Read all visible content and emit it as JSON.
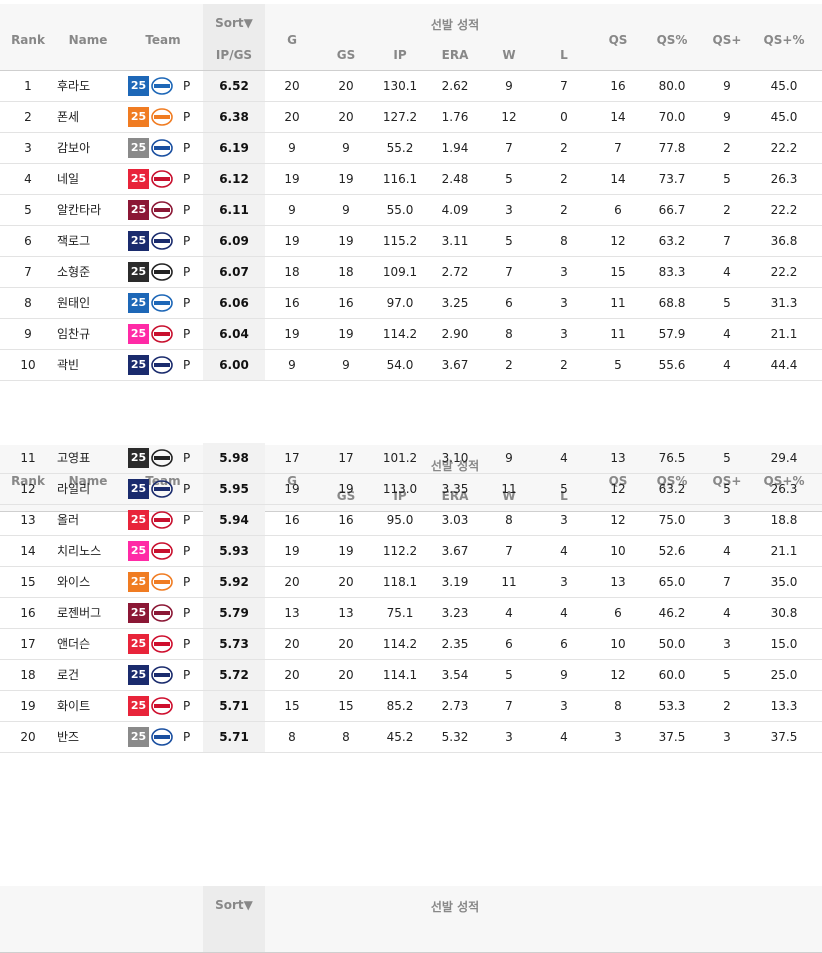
{
  "header": {
    "rank": "Rank",
    "name": "Name",
    "team": "Team",
    "sort": "Sort▼",
    "ipgs": "IP/GS",
    "g": "G",
    "group": "선발 성적",
    "gs": "GS",
    "ip": "IP",
    "era": "ERA",
    "w": "W",
    "l": "L",
    "qs": "QS",
    "qs_pct": "QS%",
    "qs_plus": "QS+",
    "qs_plus_pct": "QS+%"
  },
  "teams": {
    "dinos": {
      "color": "#1d67b7",
      "logo": "dinos-logo-icon",
      "logo_color": "#1d67b7"
    },
    "eagles": {
      "color": "#f07c22",
      "logo": "eagles-logo-icon",
      "logo_color": "#f07c22"
    },
    "lions": {
      "color": "#8a8a8a",
      "logo": "lions-logo-icon",
      "logo_color": "#1a4fa0"
    },
    "twins": {
      "color": "#e8243a",
      "logo": "twins-logo-icon",
      "logo_color": "#c8102e"
    },
    "wiz": {
      "color": "#2b2b2b",
      "logo": "wiz-logo-icon",
      "logo_color": "#222"
    },
    "landers": {
      "color": "#e8243a",
      "logo": "landers-logo-icon",
      "logo_color": "#ce0e2d"
    },
    "bears": {
      "color": "#1a2b6d",
      "logo": "bears-logo-icon",
      "logo_color": "#1a2b6d"
    },
    "heroes": {
      "color": "#8b1735",
      "logo": "heroes-logo-icon",
      "logo_color": "#8b1735"
    },
    "giants": {
      "color": "#1a2b6d",
      "logo": "giants-logo-icon",
      "logo_color": "#1a2b6d"
    },
    "twins_pink": {
      "color": "#ff2aa6",
      "logo": "twins-logo-icon",
      "logo_color": "#c8102e"
    }
  },
  "sections": [
    {
      "rows": [
        {
          "rank": "1",
          "name": "후라도",
          "year": "25",
          "team": "dinos",
          "pos": "P",
          "ipgs": "6.52",
          "g": "20",
          "gs": "20",
          "ip": "130.1",
          "era": "2.62",
          "w": "9",
          "l": "7",
          "qs": "16",
          "qs_pct": "80.0",
          "qs_plus": "9",
          "qs_plus_pct": "45.0"
        },
        {
          "rank": "2",
          "name": "폰세",
          "year": "25",
          "team": "eagles",
          "pos": "P",
          "ipgs": "6.38",
          "g": "20",
          "gs": "20",
          "ip": "127.2",
          "era": "1.76",
          "w": "12",
          "l": "0",
          "qs": "14",
          "qs_pct": "70.0",
          "qs_plus": "9",
          "qs_plus_pct": "45.0"
        },
        {
          "rank": "3",
          "name": "감보아",
          "year": "25",
          "team": "lions",
          "pos": "P",
          "ipgs": "6.19",
          "g": "9",
          "gs": "9",
          "ip": "55.2",
          "era": "1.94",
          "w": "7",
          "l": "2",
          "qs": "7",
          "qs_pct": "77.8",
          "qs_plus": "2",
          "qs_plus_pct": "22.2"
        },
        {
          "rank": "4",
          "name": "네일",
          "year": "25",
          "team": "twins",
          "pos": "P",
          "ipgs": "6.12",
          "g": "19",
          "gs": "19",
          "ip": "116.1",
          "era": "2.48",
          "w": "5",
          "l": "2",
          "qs": "14",
          "qs_pct": "73.7",
          "qs_plus": "5",
          "qs_plus_pct": "26.3"
        },
        {
          "rank": "5",
          "name": "알칸타라",
          "year": "25",
          "team": "heroes",
          "pos": "P",
          "ipgs": "6.11",
          "g": "9",
          "gs": "9",
          "ip": "55.0",
          "era": "4.09",
          "w": "3",
          "l": "2",
          "qs": "6",
          "qs_pct": "66.7",
          "qs_plus": "2",
          "qs_plus_pct": "22.2"
        },
        {
          "rank": "6",
          "name": "잭로그",
          "year": "25",
          "team": "giants",
          "pos": "P",
          "ipgs": "6.09",
          "g": "19",
          "gs": "19",
          "ip": "115.2",
          "era": "3.11",
          "w": "5",
          "l": "8",
          "qs": "12",
          "qs_pct": "63.2",
          "qs_plus": "7",
          "qs_plus_pct": "36.8"
        },
        {
          "rank": "7",
          "name": "소형준",
          "year": "25",
          "team": "wiz",
          "pos": "P",
          "ipgs": "6.07",
          "g": "18",
          "gs": "18",
          "ip": "109.1",
          "era": "2.72",
          "w": "7",
          "l": "3",
          "qs": "15",
          "qs_pct": "83.3",
          "qs_plus": "4",
          "qs_plus_pct": "22.2"
        },
        {
          "rank": "8",
          "name": "원태인",
          "year": "25",
          "team": "dinos",
          "pos": "P",
          "ipgs": "6.06",
          "g": "16",
          "gs": "16",
          "ip": "97.0",
          "era": "3.25",
          "w": "6",
          "l": "3",
          "qs": "11",
          "qs_pct": "68.8",
          "qs_plus": "5",
          "qs_plus_pct": "31.3"
        },
        {
          "rank": "9",
          "name": "임찬규",
          "year": "25",
          "team": "twins_pink",
          "pos": "P",
          "ipgs": "6.04",
          "g": "19",
          "gs": "19",
          "ip": "114.2",
          "era": "2.90",
          "w": "8",
          "l": "3",
          "qs": "11",
          "qs_pct": "57.9",
          "qs_plus": "4",
          "qs_plus_pct": "21.1"
        },
        {
          "rank": "10",
          "name": "곽빈",
          "year": "25",
          "team": "giants",
          "pos": "P",
          "ipgs": "6.00",
          "g": "9",
          "gs": "9",
          "ip": "54.0",
          "era": "3.67",
          "w": "2",
          "l": "2",
          "qs": "5",
          "qs_pct": "55.6",
          "qs_plus": "4",
          "qs_plus_pct": "44.4"
        }
      ]
    },
    {
      "rows": [
        {
          "rank": "11",
          "name": "고영표",
          "year": "25",
          "team": "wiz",
          "pos": "P",
          "ipgs": "5.98",
          "g": "17",
          "gs": "17",
          "ip": "101.2",
          "era": "3.10",
          "w": "9",
          "l": "4",
          "qs": "13",
          "qs_pct": "76.5",
          "qs_plus": "5",
          "qs_plus_pct": "29.4"
        },
        {
          "rank": "12",
          "name": "라일리",
          "year": "25",
          "team": "bears",
          "pos": "P",
          "ipgs": "5.95",
          "g": "19",
          "gs": "19",
          "ip": "113.0",
          "era": "3.35",
          "w": "11",
          "l": "5",
          "qs": "12",
          "qs_pct": "63.2",
          "qs_plus": "5",
          "qs_plus_pct": "26.3"
        },
        {
          "rank": "13",
          "name": "올러",
          "year": "25",
          "team": "twins",
          "pos": "P",
          "ipgs": "5.94",
          "g": "16",
          "gs": "16",
          "ip": "95.0",
          "era": "3.03",
          "w": "8",
          "l": "3",
          "qs": "12",
          "qs_pct": "75.0",
          "qs_plus": "3",
          "qs_plus_pct": "18.8"
        },
        {
          "rank": "14",
          "name": "치리노스",
          "year": "25",
          "team": "twins_pink",
          "pos": "P",
          "ipgs": "5.93",
          "g": "19",
          "gs": "19",
          "ip": "112.2",
          "era": "3.67",
          "w": "7",
          "l": "4",
          "qs": "10",
          "qs_pct": "52.6",
          "qs_plus": "4",
          "qs_plus_pct": "21.1"
        },
        {
          "rank": "15",
          "name": "와이스",
          "year": "25",
          "team": "eagles",
          "pos": "P",
          "ipgs": "5.92",
          "g": "20",
          "gs": "20",
          "ip": "118.1",
          "era": "3.19",
          "w": "11",
          "l": "3",
          "qs": "13",
          "qs_pct": "65.0",
          "qs_plus": "7",
          "qs_plus_pct": "35.0"
        },
        {
          "rank": "16",
          "name": "로젠버그",
          "year": "25",
          "team": "heroes",
          "pos": "P",
          "ipgs": "5.79",
          "g": "13",
          "gs": "13",
          "ip": "75.1",
          "era": "3.23",
          "w": "4",
          "l": "4",
          "qs": "6",
          "qs_pct": "46.2",
          "qs_plus": "4",
          "qs_plus_pct": "30.8"
        },
        {
          "rank": "17",
          "name": "앤더슨",
          "year": "25",
          "team": "landers",
          "pos": "P",
          "ipgs": "5.73",
          "g": "20",
          "gs": "20",
          "ip": "114.2",
          "era": "2.35",
          "w": "6",
          "l": "6",
          "qs": "10",
          "qs_pct": "50.0",
          "qs_plus": "3",
          "qs_plus_pct": "15.0"
        },
        {
          "rank": "18",
          "name": "로건",
          "year": "25",
          "team": "bears",
          "pos": "P",
          "ipgs": "5.72",
          "g": "20",
          "gs": "20",
          "ip": "114.1",
          "era": "3.54",
          "w": "5",
          "l": "9",
          "qs": "12",
          "qs_pct": "60.0",
          "qs_plus": "5",
          "qs_plus_pct": "25.0"
        },
        {
          "rank": "19",
          "name": "화이트",
          "year": "25",
          "team": "landers",
          "pos": "P",
          "ipgs": "5.71",
          "g": "15",
          "gs": "15",
          "ip": "85.2",
          "era": "2.73",
          "w": "7",
          "l": "3",
          "qs": "8",
          "qs_pct": "53.3",
          "qs_plus": "2",
          "qs_plus_pct": "13.3"
        },
        {
          "rank": "20",
          "name": "반즈",
          "year": "25",
          "team": "lions",
          "pos": "P",
          "ipgs": "5.71",
          "g": "8",
          "gs": "8",
          "ip": "45.2",
          "era": "5.32",
          "w": "3",
          "l": "4",
          "qs": "3",
          "qs_pct": "37.5",
          "qs_plus": "3",
          "qs_plus_pct": "37.5"
        }
      ]
    },
    {
      "rows": []
    }
  ]
}
